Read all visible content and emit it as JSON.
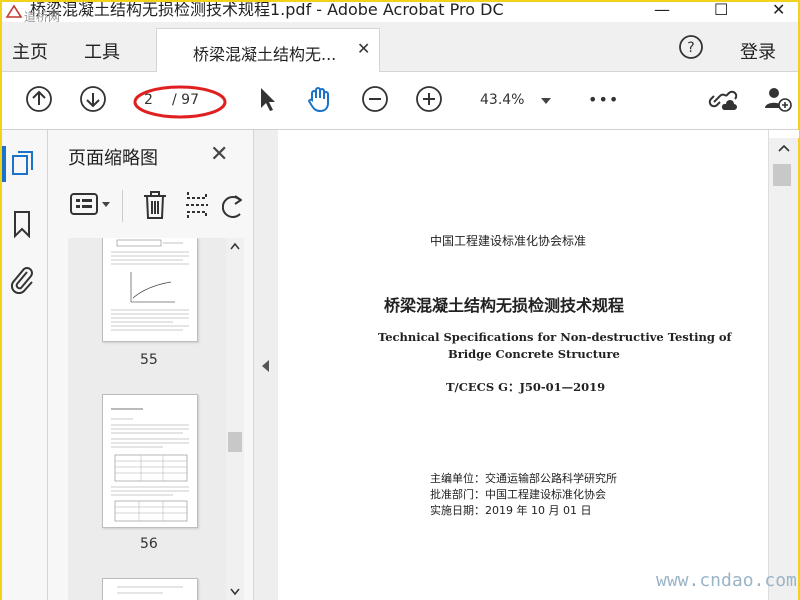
{
  "window": {
    "title": "桥梁混凝土结构无损检测技术规程1.pdf - Adobe Acrobat Pro DC",
    "watermark_top": "道桥网",
    "controls": {
      "minimize": "—",
      "maximize": "☐",
      "close": "✕"
    }
  },
  "menu": {
    "home": "主页",
    "tools": "工具",
    "doc_tab": "桥梁混凝土结构无...",
    "help": "?",
    "login": "登录"
  },
  "toolbar": {
    "current_page": "2",
    "total_pages": "/ 97",
    "zoom": "43.4%",
    "more": "•••"
  },
  "panel": {
    "title": "页面缩略图",
    "thumbnails": [
      {
        "label": "55"
      },
      {
        "label": "56"
      }
    ]
  },
  "document": {
    "org_standard": "中国工程建设标准化协会标准",
    "title_cn": "桥梁混凝土结构无损检测技术规程",
    "title_en_line1": "Technical Specifications for Non-destructive Testing of",
    "title_en_line2": "Bridge Concrete Structure",
    "code": "T/CECS G：J50-01—2019",
    "editor": "主编单位：交通运输部公路科学研究所",
    "approver": "批准部门：中国工程建设标准化协会",
    "effective": "实施日期：2019 年 10 月 01 日"
  },
  "watermark": "www.cndao.com",
  "colors": {
    "accent": "#1a73c8",
    "annotation": "#e02020",
    "frame": "#f2d21a"
  }
}
